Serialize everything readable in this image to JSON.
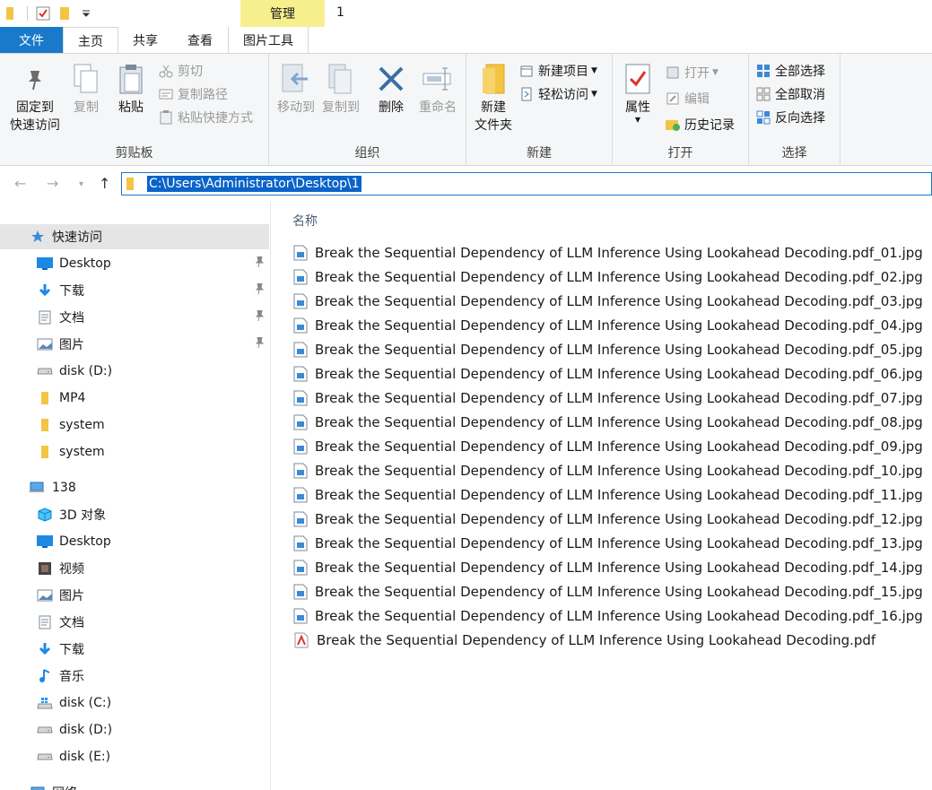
{
  "titlebar": {
    "context_tab": "管理",
    "window_title": "1"
  },
  "tabs": [
    "文件",
    "主页",
    "共享",
    "查看",
    "图片工具"
  ],
  "ribbon": {
    "clipboard": {
      "label": "剪贴板",
      "pin_quick_access": "固定到\n快速访问",
      "pin_line1": "固定到",
      "pin_line2": "快速访问",
      "copy": "复制",
      "paste": "粘贴",
      "cut": "剪切",
      "copy_path": "复制路径",
      "paste_shortcut": "粘贴快捷方式"
    },
    "organize": {
      "label": "组织",
      "move_to": "移动到",
      "copy_to": "复制到",
      "delete": "删除",
      "rename": "重命名"
    },
    "new": {
      "label": "新建",
      "new_folder_line1": "新建",
      "new_folder_line2": "文件夹",
      "new_item": "新建项目",
      "easy_access": "轻松访问"
    },
    "open": {
      "label": "打开",
      "properties": "属性",
      "open": "打开",
      "edit": "编辑",
      "history": "历史记录"
    },
    "select": {
      "label": "选择",
      "select_all": "全部选择",
      "select_none": "全部取消",
      "invert": "反向选择"
    }
  },
  "address": {
    "path": "C:\\Users\\Administrator\\Desktop\\1"
  },
  "nav": {
    "quick_access": "快速访问",
    "items": [
      {
        "label": "Desktop",
        "icon": "desktop-icon"
      },
      {
        "label": "下载",
        "icon": "download-icon"
      },
      {
        "label": "文档",
        "icon": "document-icon"
      },
      {
        "label": "图片",
        "icon": "pictures-icon"
      },
      {
        "label": "disk (D:)",
        "icon": "drive-icon"
      },
      {
        "label": "MP4",
        "icon": "folder-icon"
      },
      {
        "label": "system",
        "icon": "folder-icon"
      },
      {
        "label": "system",
        "icon": "folder-icon"
      }
    ],
    "pc": "138",
    "pc_items": [
      {
        "label": "3D 对象",
        "icon": "3d-objects-icon"
      },
      {
        "label": "Desktop",
        "icon": "desktop-icon"
      },
      {
        "label": "视频",
        "icon": "video-icon"
      },
      {
        "label": "图片",
        "icon": "pictures-icon"
      },
      {
        "label": "文档",
        "icon": "document-icon"
      },
      {
        "label": "下载",
        "icon": "download-icon"
      },
      {
        "label": "音乐",
        "icon": "music-icon"
      },
      {
        "label": "disk (C:)",
        "icon": "windows-drive-icon"
      },
      {
        "label": "disk (D:)",
        "icon": "drive-icon"
      },
      {
        "label": "disk (E:)",
        "icon": "drive-icon"
      }
    ],
    "network": "网络"
  },
  "files": {
    "column_name": "名称",
    "items": [
      {
        "name": "Break the Sequential Dependency of LLM Inference Using Lookahead Decoding.pdf_01.jpg",
        "type": "jpg"
      },
      {
        "name": "Break the Sequential Dependency of LLM Inference Using Lookahead Decoding.pdf_02.jpg",
        "type": "jpg"
      },
      {
        "name": "Break the Sequential Dependency of LLM Inference Using Lookahead Decoding.pdf_03.jpg",
        "type": "jpg"
      },
      {
        "name": "Break the Sequential Dependency of LLM Inference Using Lookahead Decoding.pdf_04.jpg",
        "type": "jpg"
      },
      {
        "name": "Break the Sequential Dependency of LLM Inference Using Lookahead Decoding.pdf_05.jpg",
        "type": "jpg"
      },
      {
        "name": "Break the Sequential Dependency of LLM Inference Using Lookahead Decoding.pdf_06.jpg",
        "type": "jpg"
      },
      {
        "name": "Break the Sequential Dependency of LLM Inference Using Lookahead Decoding.pdf_07.jpg",
        "type": "jpg"
      },
      {
        "name": "Break the Sequential Dependency of LLM Inference Using Lookahead Decoding.pdf_08.jpg",
        "type": "jpg"
      },
      {
        "name": "Break the Sequential Dependency of LLM Inference Using Lookahead Decoding.pdf_09.jpg",
        "type": "jpg"
      },
      {
        "name": "Break the Sequential Dependency of LLM Inference Using Lookahead Decoding.pdf_10.jpg",
        "type": "jpg"
      },
      {
        "name": "Break the Sequential Dependency of LLM Inference Using Lookahead Decoding.pdf_11.jpg",
        "type": "jpg"
      },
      {
        "name": "Break the Sequential Dependency of LLM Inference Using Lookahead Decoding.pdf_12.jpg",
        "type": "jpg"
      },
      {
        "name": "Break the Sequential Dependency of LLM Inference Using Lookahead Decoding.pdf_13.jpg",
        "type": "jpg"
      },
      {
        "name": "Break the Sequential Dependency of LLM Inference Using Lookahead Decoding.pdf_14.jpg",
        "type": "jpg"
      },
      {
        "name": "Break the Sequential Dependency of LLM Inference Using Lookahead Decoding.pdf_15.jpg",
        "type": "jpg"
      },
      {
        "name": "Break the Sequential Dependency of LLM Inference Using Lookahead Decoding.pdf_16.jpg",
        "type": "jpg"
      },
      {
        "name": "Break the Sequential Dependency of LLM Inference Using Lookahead Decoding.pdf",
        "type": "pdf"
      }
    ]
  },
  "colors": {
    "accent": "#1979ca",
    "selection": "#0a63c9",
    "context_tab": "#f7ef8e",
    "folder": "#f4c542"
  }
}
